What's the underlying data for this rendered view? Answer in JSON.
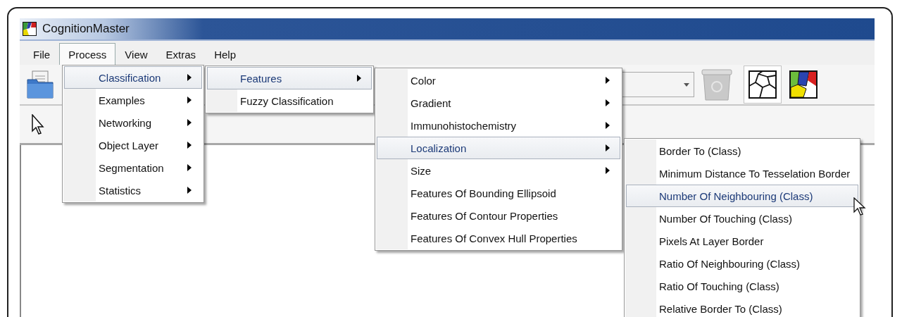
{
  "window": {
    "title": "CognitionMaster"
  },
  "menu_bar": [
    {
      "label": "File",
      "selected": false
    },
    {
      "label": "Process",
      "selected": true
    },
    {
      "label": "View",
      "selected": false
    },
    {
      "label": "Extras",
      "selected": false
    },
    {
      "label": "Help",
      "selected": false
    }
  ],
  "toolbar": {
    "view_buttons": [
      {
        "kind": "outline",
        "selected": true
      },
      {
        "kind": "colored",
        "selected": false
      }
    ]
  },
  "menus": [
    {
      "items": [
        {
          "label": "Classification",
          "has_submenu": true,
          "selected": true
        },
        {
          "label": "Examples",
          "has_submenu": true,
          "selected": false
        },
        {
          "label": "Networking",
          "has_submenu": true,
          "selected": false
        },
        {
          "label": "Object Layer",
          "has_submenu": true,
          "selected": false
        },
        {
          "label": "Segmentation",
          "has_submenu": true,
          "selected": false
        },
        {
          "label": "Statistics",
          "has_submenu": true,
          "selected": false
        }
      ]
    },
    {
      "items": [
        {
          "label": "Features",
          "has_submenu": true,
          "selected": true
        },
        {
          "label": "Fuzzy Classification",
          "has_submenu": false,
          "selected": false
        }
      ]
    },
    {
      "items": [
        {
          "label": "Color",
          "has_submenu": true,
          "selected": false
        },
        {
          "label": "Gradient",
          "has_submenu": true,
          "selected": false
        },
        {
          "label": "Immunohistochemistry",
          "has_submenu": true,
          "selected": false
        },
        {
          "label": "Localization",
          "has_submenu": true,
          "selected": true
        },
        {
          "label": "Size",
          "has_submenu": true,
          "selected": false
        },
        {
          "label": "Features Of Bounding Ellipsoid",
          "has_submenu": false,
          "selected": false
        },
        {
          "label": "Features Of Contour Properties",
          "has_submenu": false,
          "selected": false
        },
        {
          "label": "Features Of Convex Hull Properties",
          "has_submenu": false,
          "selected": false
        }
      ]
    },
    {
      "items": [
        {
          "label": "Border To (Class)",
          "has_submenu": false,
          "selected": false
        },
        {
          "label": "Minimum Distance To Tesselation Border",
          "has_submenu": false,
          "selected": false
        },
        {
          "label": "Number Of Neighbouring (Class)",
          "has_submenu": false,
          "selected": true
        },
        {
          "label": "Number Of Touching (Class)",
          "has_submenu": false,
          "selected": false
        },
        {
          "label": "Pixels At Layer Border",
          "has_submenu": false,
          "selected": false
        },
        {
          "label": "Ratio Of Neighbouring (Class)",
          "has_submenu": false,
          "selected": false
        },
        {
          "label": "Ratio Of Touching (Class)",
          "has_submenu": false,
          "selected": false
        },
        {
          "label": "Relative Border To (Class)",
          "has_submenu": false,
          "selected": false
        }
      ]
    }
  ]
}
